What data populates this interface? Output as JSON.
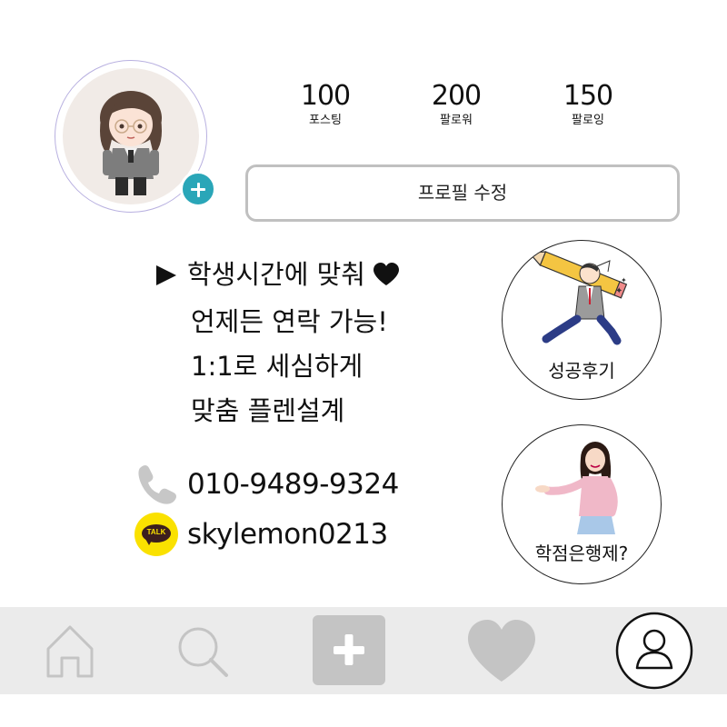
{
  "profile": {
    "avatar_alt": "profile avatar",
    "stats": [
      {
        "value": "100",
        "label": "포스팅"
      },
      {
        "value": "200",
        "label": "팔로워"
      },
      {
        "value": "150",
        "label": "팔로잉"
      }
    ],
    "edit_button": "프로필 수정"
  },
  "bio": {
    "line1": "학생시간에 맞춰",
    "line2": "언제든 연락 가능!",
    "line3": "1:1로 세심하게",
    "line4": "맞춤 플렌설계"
  },
  "contacts": {
    "phone": "010-9489-9324",
    "kakao_id": "skylemon0213",
    "kakao_badge": "TALK"
  },
  "highlights": [
    {
      "label": "성공후기"
    },
    {
      "label": "학점은행제?"
    }
  ],
  "nav": {
    "items": [
      "home-icon",
      "search-icon",
      "add-post-icon",
      "heart-icon",
      "profile-icon"
    ]
  },
  "colors": {
    "accent_plus": "#2aa6b8",
    "kakao_yellow": "#fae100",
    "nav_bg": "#ebebeb",
    "icon_gray": "#c4c4c4"
  }
}
